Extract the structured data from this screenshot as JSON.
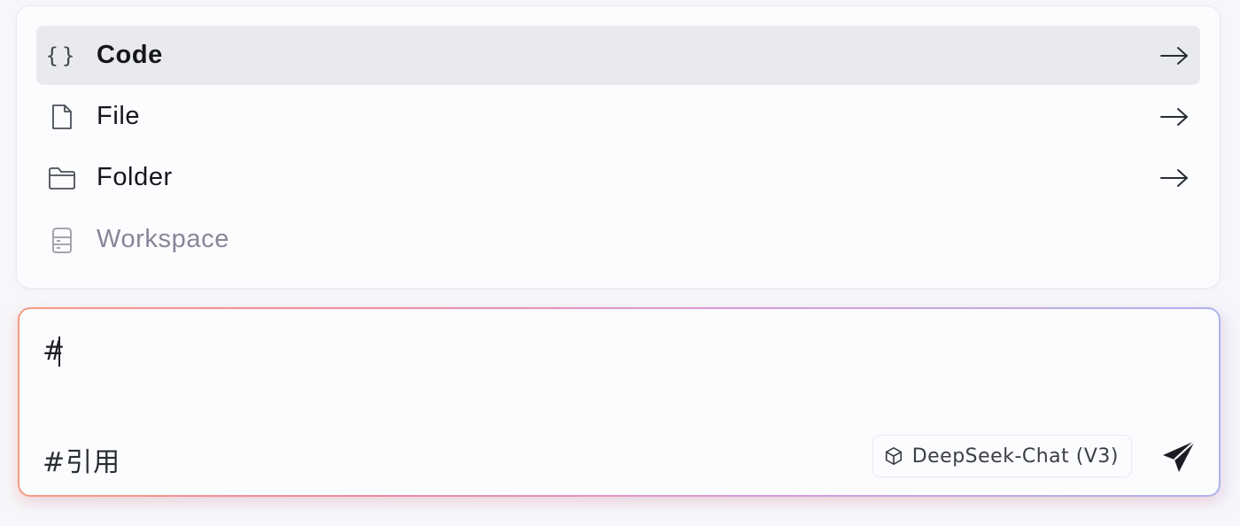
{
  "menu": {
    "items": [
      {
        "label": "Code",
        "icon": "code-braces-icon",
        "state": "active"
      },
      {
        "label": "File",
        "icon": "file-icon",
        "state": "normal"
      },
      {
        "label": "Folder",
        "icon": "folder-icon",
        "state": "normal"
      },
      {
        "label": "Workspace",
        "icon": "workspace-icon",
        "state": "disabled"
      }
    ],
    "arrow_icon": "arrow-right-icon"
  },
  "input": {
    "value": "#",
    "reference_label": "#引用",
    "model_chip": {
      "label": "DeepSeek-Chat (V3)",
      "icon": "cube-icon"
    },
    "send_icon": "paper-plane-icon"
  },
  "colors": {
    "active_item_bg": "#e9eaee",
    "disabled_text": "#8b8499",
    "gradient_start": "#f49a82",
    "gradient_end": "#aeb2ec"
  }
}
